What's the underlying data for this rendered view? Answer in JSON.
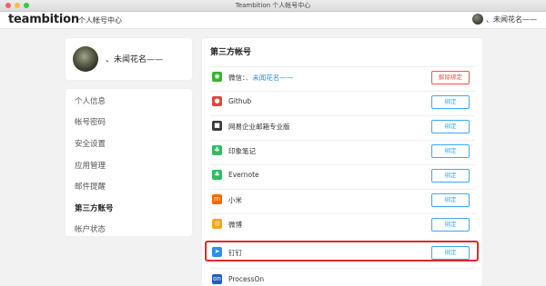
{
  "window": {
    "title": "Teambition 个人帐号中心"
  },
  "header": {
    "logo": "teambition",
    "subtitle": "个人帐号中心",
    "user_name": "、未闻花名——"
  },
  "profile": {
    "name": "、未闻花名——"
  },
  "menu": {
    "items": [
      {
        "label": "个人信息",
        "active": false
      },
      {
        "label": "帐号密码",
        "active": false
      },
      {
        "label": "安全设置",
        "active": false
      },
      {
        "label": "应用管理",
        "active": false
      },
      {
        "label": "邮件提醒",
        "active": false
      },
      {
        "label": "第三方账号",
        "active": true
      },
      {
        "label": "帐户状态",
        "active": false
      }
    ]
  },
  "panel": {
    "title": "第三方帐号",
    "wechat": {
      "prefix": "微信：",
      "account": "、未闻花名——",
      "button": "解除绑定"
    },
    "services": [
      {
        "name": "Github",
        "icon": "github-icon",
        "color": "#e7433e",
        "button": "绑定"
      },
      {
        "name": "网易企业邮箱专业版",
        "icon": "netease-mail-icon",
        "color": "#3b3b3b",
        "button": "绑定"
      },
      {
        "name": "印象笔记",
        "icon": "evernote-icon",
        "color": "#2dbe60",
        "button": "绑定"
      },
      {
        "name": "Evernote",
        "icon": "evernote-icon",
        "color": "#2dbe60",
        "button": "绑定"
      },
      {
        "name": "小米",
        "icon": "xiaomi-icon",
        "color": "#ff6700",
        "button": "绑定"
      },
      {
        "name": "微博",
        "icon": "weibo-icon",
        "color": "#f5a623",
        "button": "绑定"
      },
      {
        "name": "钉钉",
        "icon": "dingtalk-icon",
        "color": "#2b8ef0",
        "button": "绑定"
      },
      {
        "name": "ProcessOn",
        "icon": "processon-icon",
        "color": "#1f5fbf",
        "button": ""
      }
    ]
  },
  "colors": {
    "accent": "#3da8f5",
    "danger": "#ff4f3e",
    "highlight": "#e0282e"
  }
}
